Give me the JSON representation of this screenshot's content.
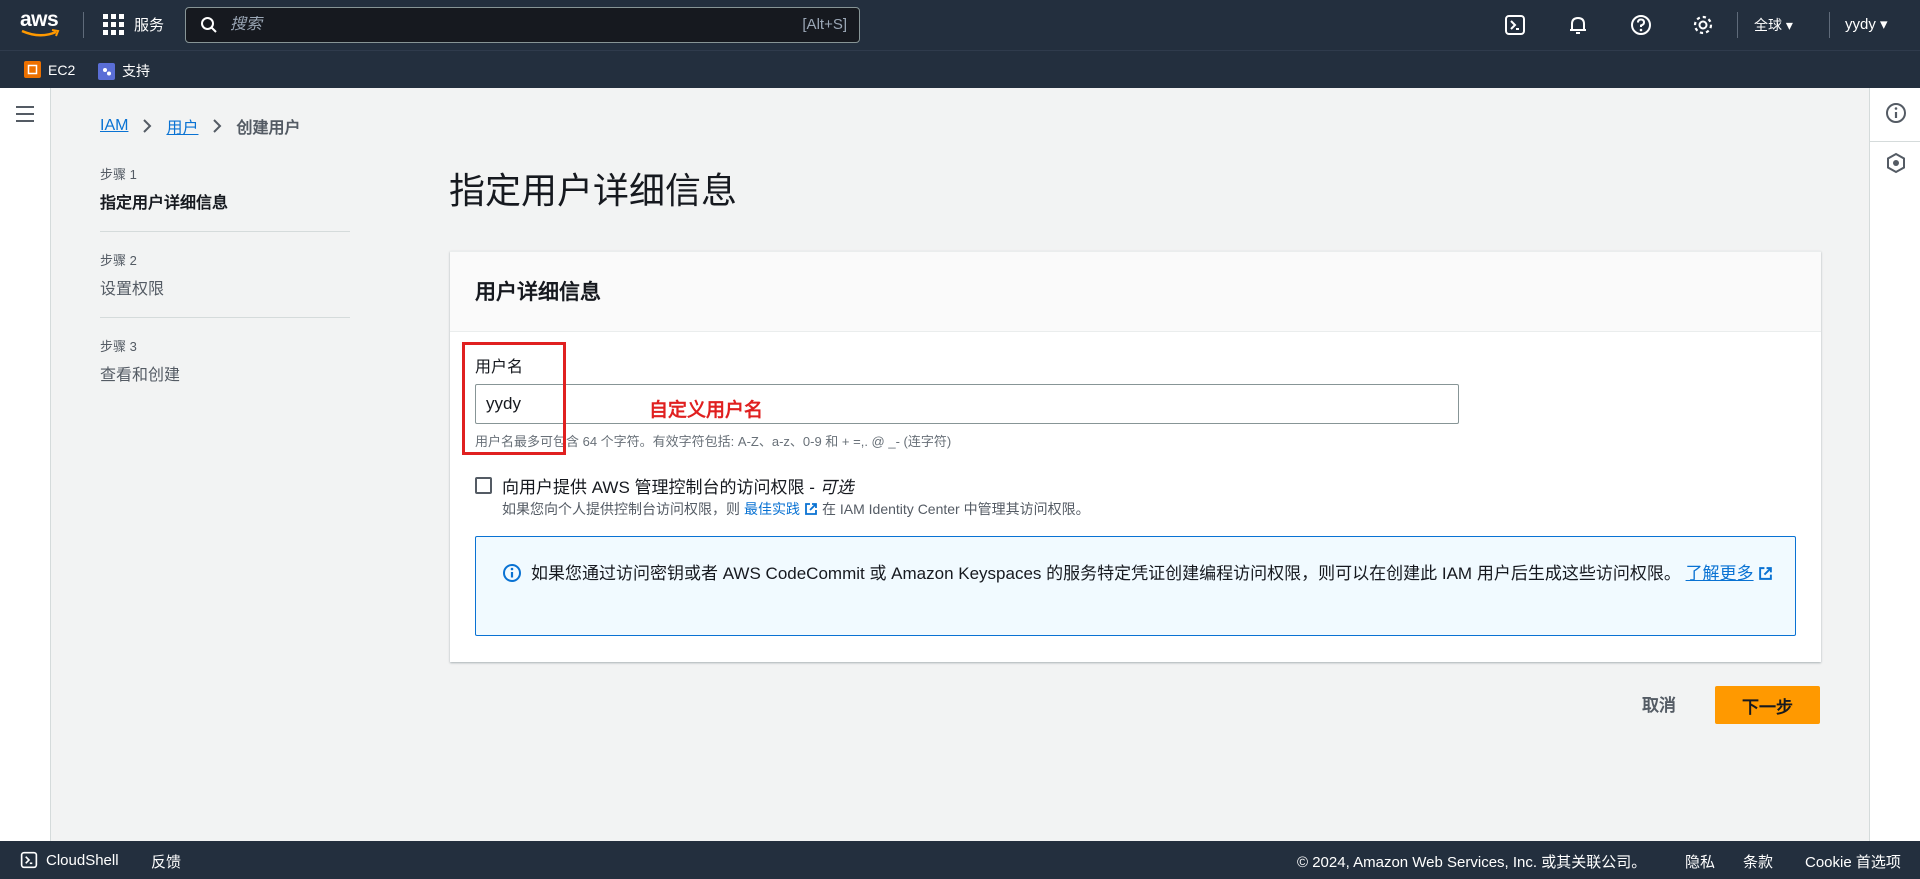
{
  "topnav": {
    "logo_text": "aws",
    "services_label": "服务",
    "search_placeholder": "搜索",
    "search_shortcut": "[Alt+S]",
    "region_label": "全球",
    "user_label": "yydy"
  },
  "favorites": [
    {
      "label": "EC2",
      "icon": "ec2-icon",
      "color": "#ed7100"
    },
    {
      "label": "支持",
      "icon": "support-icon",
      "color": "#5a6ed6"
    }
  ],
  "breadcrumb": {
    "items": [
      "IAM",
      "用户"
    ],
    "current": "创建用户"
  },
  "steps": [
    {
      "number": "步骤 1",
      "title": "指定用户详细信息",
      "active": true
    },
    {
      "number": "步骤 2",
      "title": "设置权限",
      "active": false
    },
    {
      "number": "步骤 3",
      "title": "查看和创建",
      "active": false
    }
  ],
  "page_title": "指定用户详细信息",
  "panel": {
    "title": "用户详细信息",
    "username_label": "用户名",
    "username_value": "yydy",
    "username_hint": "用户名最多可包含 64 个字符。有效字符包括: A-Z、a-z、0-9 和 + =,. @ _- (连字符)",
    "annotation": "自定义用户名",
    "console_access_label": "向用户提供 AWS 管理控制台的访问权限 - ",
    "console_access_optional": "可选",
    "console_desc_before": "如果您向个人提供控制台访问权限，则",
    "console_desc_link": "最佳实践",
    "console_desc_after": "在 IAM Identity Center 中管理其访问权限。",
    "info_text": "如果您通过访问密钥或者 AWS CodeCommit 或 Amazon Keyspaces 的服务特定凭证创建编程访问权限，则可以在创建此 IAM 用户后生成这些访问权限。",
    "info_link": "了解更多"
  },
  "actions": {
    "cancel_label": "取消",
    "next_label": "下一步"
  },
  "footer": {
    "cloudshell_label": "CloudShell",
    "feedback_label": "反馈",
    "copyright": "© 2024, Amazon Web Services, Inc. 或其关联公司。",
    "privacy_label": "隐私",
    "terms_label": "条款",
    "cookie_label": "Cookie 首选项"
  },
  "colors": {
    "nav_bg": "#232f3e",
    "link_blue": "#0972d3",
    "primary_orange": "#ff9900",
    "annotation_red": "#e02020"
  }
}
